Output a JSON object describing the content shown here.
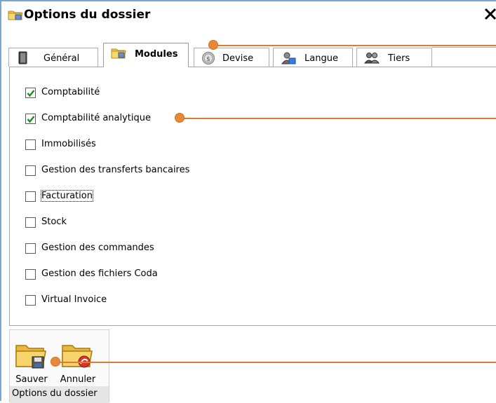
{
  "window": {
    "title": "Options du dossier",
    "close_symbol": "✕",
    "title_icon": "folder-options-icon"
  },
  "tabs": [
    {
      "label": "Général",
      "icon": "book-icon",
      "active": false
    },
    {
      "label": "Modules",
      "icon": "folder-modules-icon",
      "active": true
    },
    {
      "label": "Devise",
      "icon": "currency-coin-icon",
      "active": false
    },
    {
      "label": "Langue",
      "icon": "language-person-icon",
      "active": false
    },
    {
      "label": "Tiers",
      "icon": "people-icon",
      "active": false
    }
  ],
  "modules": [
    {
      "label": "Comptabilité",
      "checked": true
    },
    {
      "label": "Comptabilité analytique",
      "checked": true
    },
    {
      "label": "Immobilisés",
      "checked": false
    },
    {
      "label": "Gestion des transferts bancaires",
      "checked": false
    },
    {
      "label": "Facturation",
      "checked": false,
      "focused": true
    },
    {
      "label": "Stock",
      "checked": false
    },
    {
      "label": "Gestion des commandes",
      "checked": false
    },
    {
      "label": "Gestion des fichiers Coda",
      "checked": false
    },
    {
      "label": "Virtual Invoice",
      "checked": false
    }
  ],
  "ribbon": {
    "save_label": "Sauver",
    "cancel_label": "Annuler",
    "group_label": "Options du dossier",
    "save_icon": "folder-save-icon",
    "cancel_icon": "folder-cancel-icon"
  },
  "colors": {
    "callout": "#e68a3a",
    "checkmark": "#1a8f1a",
    "window_border": "#7aa6d6"
  }
}
